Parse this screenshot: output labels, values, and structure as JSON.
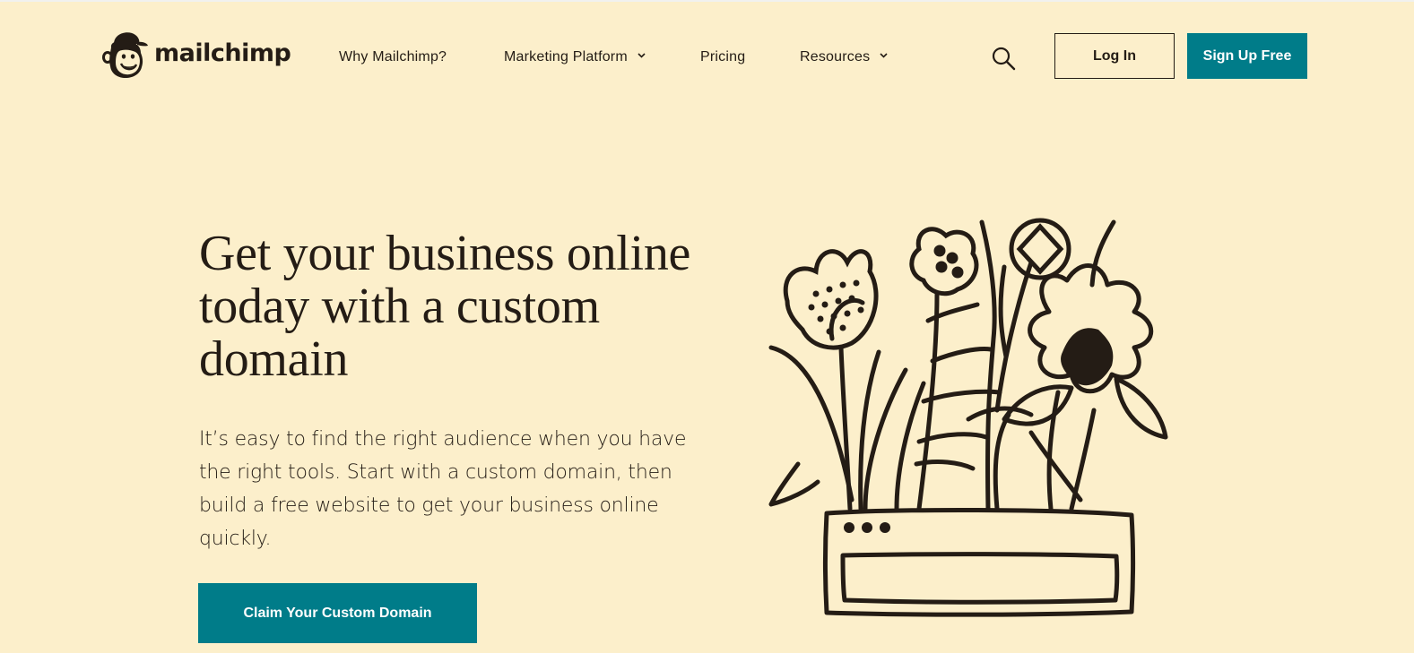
{
  "brand": {
    "name": "mailchimp",
    "accent_color": "#007c89",
    "background_color": "#fcefcb",
    "text_color": "#241c15"
  },
  "header": {
    "nav": [
      {
        "label": "Why Mailchimp?",
        "has_dropdown": false
      },
      {
        "label": "Marketing Platform",
        "has_dropdown": true
      },
      {
        "label": "Pricing",
        "has_dropdown": false
      },
      {
        "label": "Resources",
        "has_dropdown": true
      }
    ],
    "search_icon": "search-icon",
    "login_label": "Log In",
    "signup_label": "Sign Up Free"
  },
  "hero": {
    "title": "Get your business online today with a custom domain",
    "subtitle": "It’s easy to find the right audience when you have the right tools. Start with a custom domain, then build a free website to get your business online quickly.",
    "cta_label": "Claim Your Custom Domain",
    "illustration_icon": "flower-pot-browser-illustration"
  }
}
